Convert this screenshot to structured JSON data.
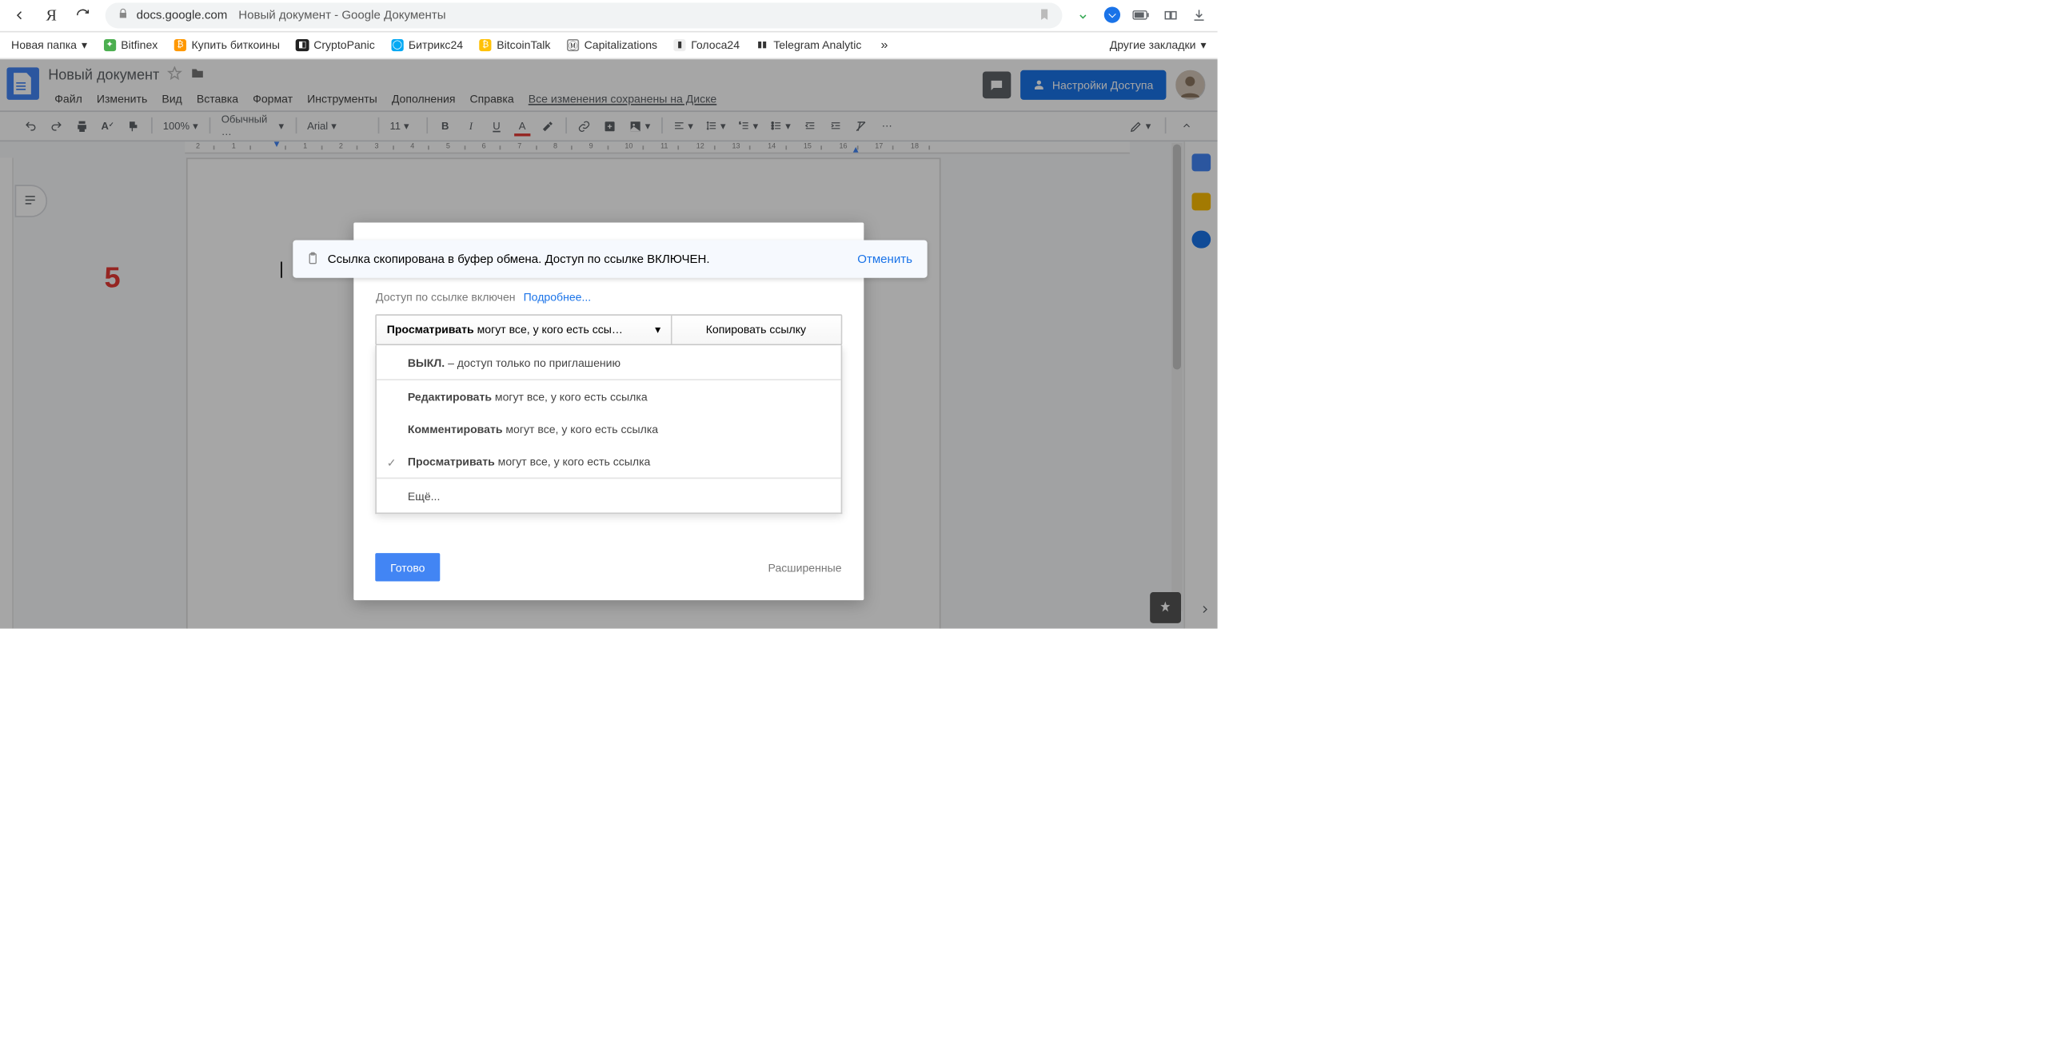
{
  "browser": {
    "domain": "docs.google.com",
    "page_title": "Новый документ - Google Документы"
  },
  "bookmarks": {
    "folder": "Новая папка",
    "items": [
      "Bitfinex",
      "Купить биткоины",
      "CryptoPanic",
      "Битрикс24",
      "BitcoinTalk",
      "Capitalizations",
      "Голоса24",
      "Telegram Analytic"
    ],
    "other": "Другие закладки"
  },
  "docs": {
    "title": "Новый документ",
    "menus": [
      "Файл",
      "Изменить",
      "Вид",
      "Вставка",
      "Формат",
      "Инструменты",
      "Дополнения",
      "Справка"
    ],
    "saved": "Все изменения сохранены на Диске",
    "share_button": "Настройки Доступа"
  },
  "toolbar": {
    "zoom": "100%",
    "style": "Обычный …",
    "font": "Arial",
    "size": "11"
  },
  "annotation": {
    "five": "5"
  },
  "dialog": {
    "toast_text": "Ссылка скопирована в буфер обмена. Доступ по ссылке ВКЛЮЧЕН.",
    "toast_undo": "Отменить",
    "link_status_label": "Доступ по ссылке включен",
    "learn_more": "Подробнее...",
    "perm_strong": "Просматривать",
    "perm_rest": " могут все, у кого есть ссы…",
    "copy_link": "Копировать ссылку",
    "options": {
      "off_strong": "ВЫКЛ.",
      "off_rest": " – доступ только по приглашению",
      "edit_strong": "Редактировать",
      "edit_rest": " могут все, у кого есть ссылка",
      "comment_strong": "Комментировать",
      "comment_rest": " могут все, у кого есть ссылка",
      "view_strong": "Просматривать",
      "view_rest": " могут все, у кого есть ссылка",
      "more": "Ещё..."
    },
    "done": "Готово",
    "advanced": "Расширенные"
  },
  "ruler_ticks": [
    "2",
    "1",
    "",
    "1",
    "2",
    "3",
    "4",
    "5",
    "6",
    "7",
    "8",
    "9",
    "10",
    "11",
    "12",
    "13",
    "14",
    "15",
    "16",
    "17",
    "18"
  ]
}
